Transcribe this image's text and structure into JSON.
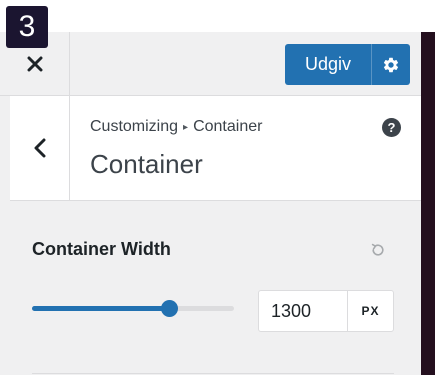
{
  "badge": {
    "number": "3"
  },
  "header": {
    "close_label": "✕",
    "publish_label": "Udgiv"
  },
  "section": {
    "breadcrumb_parent": "Customizing",
    "breadcrumb_separator": "▸",
    "breadcrumb_current": "Container",
    "title": "Container",
    "help_label": "?"
  },
  "control": {
    "title": "Container Width",
    "value": "1300",
    "unit": "PX",
    "slider_fraction": 0.68
  },
  "colors": {
    "accent": "#2271b1",
    "panel_bg": "#f0f0f1",
    "badge_bg": "#1b1530"
  },
  "icons": {
    "close": "close-icon",
    "gear": "gear-icon",
    "back": "chevron-left-icon",
    "help": "help-icon",
    "reset": "reset-icon"
  }
}
